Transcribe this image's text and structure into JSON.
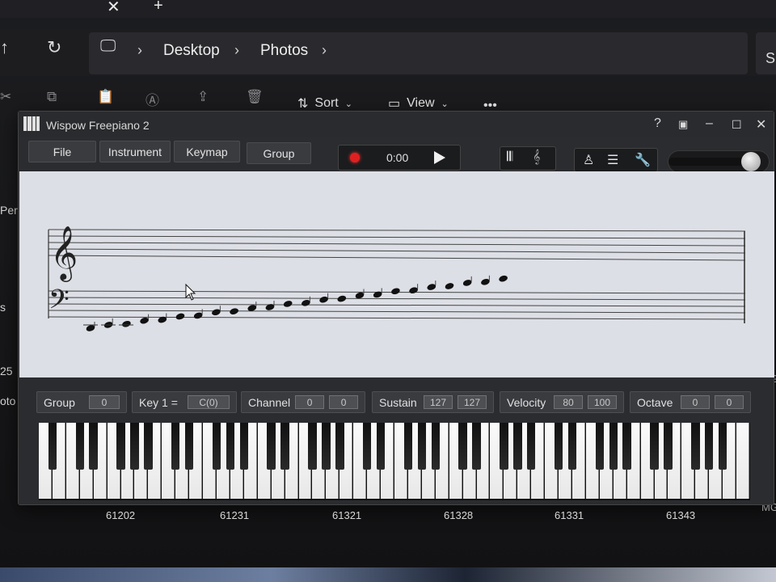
{
  "explorer": {
    "tab_close": "✕",
    "tab_new": "+",
    "nav_up": "↑",
    "nav_refresh": "↻",
    "breadcrumb": [
      "Desktop",
      "Photos"
    ],
    "search_fragment": "S",
    "toolbar": {
      "sort": "Sort",
      "view": "View",
      "more": "•••"
    },
    "sidebar_fragments": [
      "Pers",
      "s",
      "25",
      "oto"
    ],
    "right_fragments": [
      "MG",
      "MG_"
    ]
  },
  "piano": {
    "title": "Wispow Freepiano 2",
    "menu": [
      "File",
      "Instrument",
      "Keymap",
      "Group"
    ],
    "time": "0:00",
    "window_controls": [
      "?",
      "▣",
      "–",
      "☐",
      "✕"
    ],
    "volume_level": 0.9,
    "controls": {
      "group": {
        "label": "Group",
        "values": [
          "0"
        ]
      },
      "key": {
        "label": "Key  1 =",
        "values": [
          "C(0)"
        ]
      },
      "channel": {
        "label": "Channel",
        "values": [
          "0",
          "0"
        ]
      },
      "sustain": {
        "label": "Sustain",
        "values": [
          "127",
          "127"
        ]
      },
      "velocity": {
        "label": "Velocity",
        "values": [
          "80",
          "100"
        ]
      },
      "octave": {
        "label": "Octave",
        "values": [
          "0",
          "0"
        ]
      }
    },
    "white_key_count": 52,
    "note_count": 24
  },
  "key_numbers": [
    "61202",
    "61231",
    "61321",
    "61328",
    "61331",
    "61343"
  ]
}
